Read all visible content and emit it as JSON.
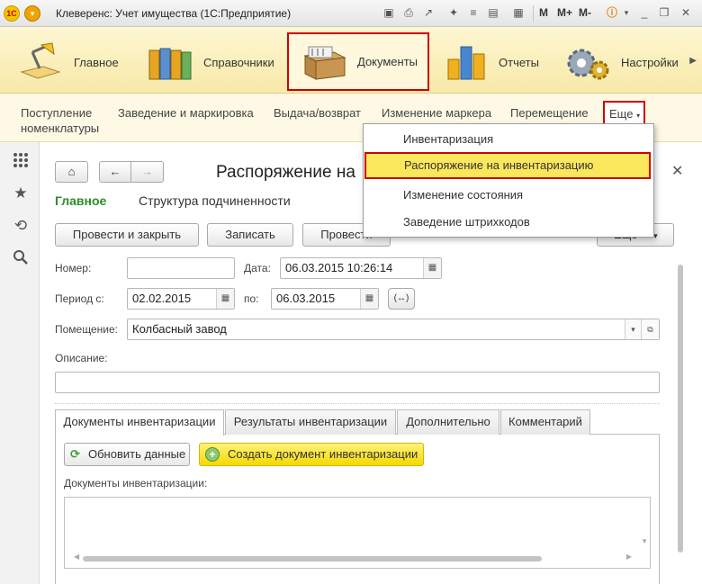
{
  "window": {
    "title": "Клеверенс: Учет имущества (1С:Предприятие)",
    "toolbar_m": "M",
    "toolbar_mplus": "M+",
    "toolbar_mminus": "M-"
  },
  "sections": [
    {
      "label": "Главное"
    },
    {
      "label": "Справочники"
    },
    {
      "label": "Документы"
    },
    {
      "label": "Отчеты"
    },
    {
      "label": "Настройки"
    }
  ],
  "nav": {
    "items": [
      "Поступление\nноменклатуры",
      "Заведение и маркировка",
      "Выдача/возврат",
      "Изменение маркера",
      "Перемещение"
    ],
    "more": "Еще"
  },
  "dropdown": {
    "items": [
      "Инвентаризация",
      "Распоряжение на инвентаризацию",
      "Изменение состояния",
      "Заведение штрихкодов"
    ]
  },
  "form": {
    "title": "Распоряжение на",
    "tab_main": "Главное",
    "tab_structure": "Структура подчиненности",
    "btn_post_close": "Провести и закрыть",
    "btn_save": "Записать",
    "btn_post": "Провести",
    "btn_more": "Еще",
    "number_label": "Номер:",
    "number_value": "",
    "date_label": "Дата:",
    "date_value": "06.03.2015 10:26:14",
    "period_label": "Период с:",
    "period_from": "02.02.2015",
    "period_to_label": "по:",
    "period_to": "06.03.2015",
    "room_label": "Помещение:",
    "room_value": "Колбасный завод",
    "desc_label": "Описание:",
    "desc_value": ""
  },
  "tabs": [
    "Документы инвентаризации",
    "Результаты инвентаризации",
    "Дополнительно",
    "Комментарий"
  ],
  "panel": {
    "btn_refresh": "Обновить данные",
    "btn_create": "Создать документ инвентаризации",
    "list_label": "Документы инвентаризации:"
  },
  "colors": {
    "highlight_border": "#d00000",
    "menu_highlight": "#fbe75b",
    "section_bg": "#f8e9a8",
    "main_tab_green": "#2e8b2e"
  }
}
